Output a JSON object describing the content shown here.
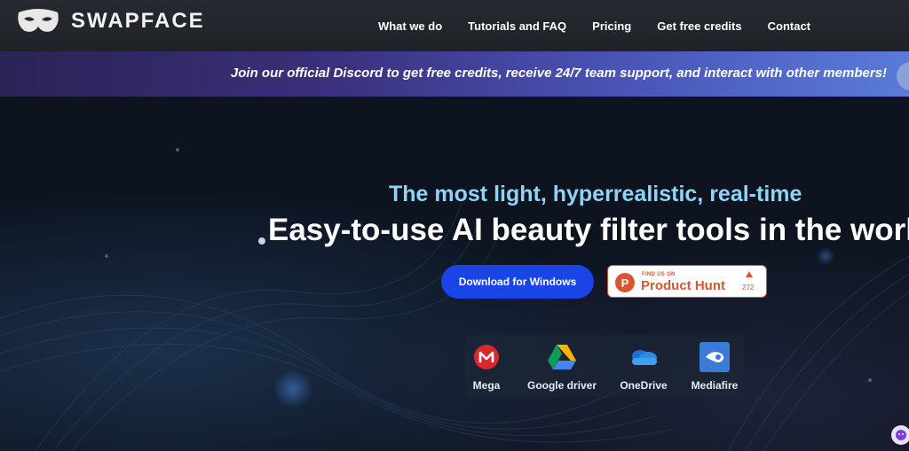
{
  "header": {
    "logo_text": "SWAPFACE",
    "nav": [
      "What we do",
      "Tutorials and FAQ",
      "Pricing",
      "Get free credits",
      "Contact"
    ]
  },
  "banner": {
    "text": "Join our official Discord to get free credits, receive 24/7 team support, and interact with other members!"
  },
  "hero": {
    "subtitle": "The most light, hyperrealistic, real-time",
    "title": "Easy-to-use AI beauty filter tools in the worl",
    "download_button": "Download for Windows",
    "product_hunt": {
      "small_text": "FIND US ON",
      "big_text": "Product Hunt",
      "logo_letter": "P",
      "upvotes": "272"
    }
  },
  "downloads": [
    {
      "label": "Mega",
      "icon": "mega-icon"
    },
    {
      "label": "Google driver",
      "icon": "google-drive-icon"
    },
    {
      "label": "OneDrive",
      "icon": "onedrive-icon"
    },
    {
      "label": "Mediafire",
      "icon": "mediafire-icon"
    }
  ],
  "colors": {
    "accent_blue": "#1a45e6",
    "subtitle_cyan": "#8fd3f5",
    "product_hunt": "#da552f",
    "mega_red": "#d9272e"
  }
}
